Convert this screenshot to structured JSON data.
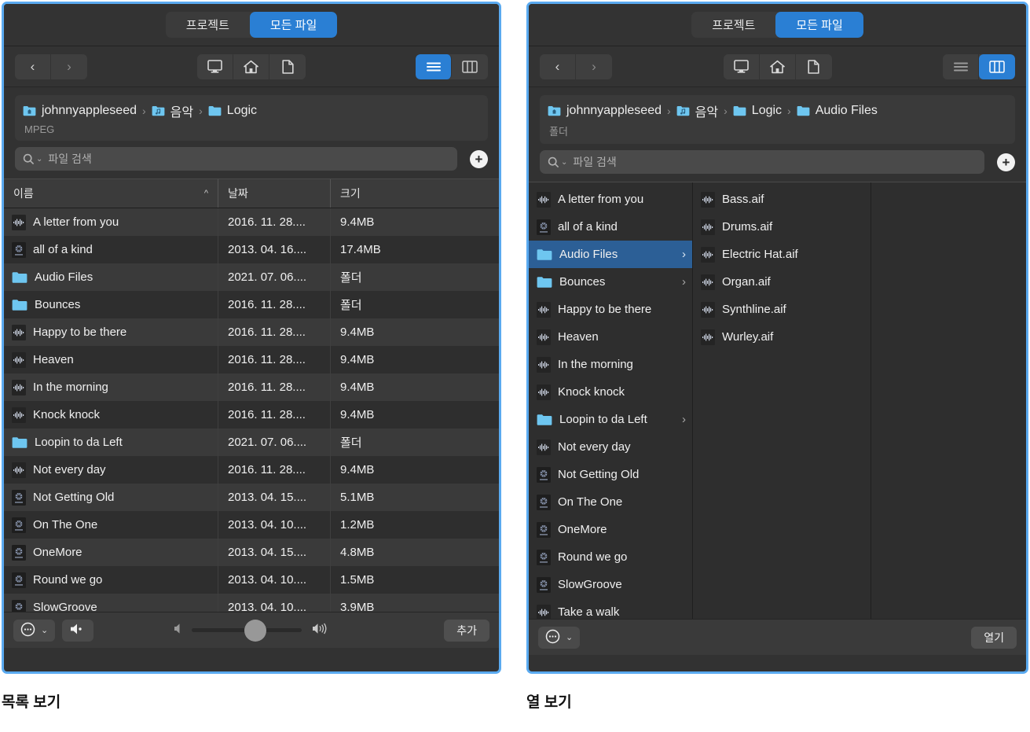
{
  "window_common": {
    "tabs": [
      {
        "label": "프로젝트",
        "active": false
      },
      {
        "label": "모든 파일",
        "active": true
      }
    ],
    "nav": {
      "back": "‹",
      "forward": "›"
    },
    "places": [
      {
        "name": "computer-icon"
      },
      {
        "name": "home-icon"
      },
      {
        "name": "document-icon"
      }
    ],
    "view_modes": [
      {
        "name": "list-view-icon"
      },
      {
        "name": "column-view-icon"
      }
    ],
    "search": {
      "placeholder": "파일 검색",
      "value": ""
    },
    "add_button": "+",
    "accent": "#2a7fd4",
    "folder_color": "#6ec6f0"
  },
  "list_panel": {
    "caption": "목록 보기",
    "view_selected": "list",
    "breadcrumb": [
      {
        "label": "johnnyappleseed",
        "icon": "home-folder-icon"
      },
      {
        "label": "음악",
        "icon": "music-folder-icon"
      },
      {
        "label": "Logic",
        "icon": "folder-icon"
      }
    ],
    "path_subtitle": "MPEG",
    "columns": [
      {
        "key": "name",
        "label": "이름",
        "sorted": true,
        "sort_arrow": "^"
      },
      {
        "key": "date",
        "label": "날짜"
      },
      {
        "key": "size",
        "label": "크기"
      }
    ],
    "rows": [
      {
        "icon": "waveform-icon",
        "name": "A letter from you",
        "date": "2016. 11. 28....",
        "size": "9.4MB"
      },
      {
        "icon": "project-icon",
        "name": "all of a kind",
        "date": "2013. 04. 16....",
        "size": "17.4MB"
      },
      {
        "icon": "folder-icon",
        "name": "Audio Files",
        "date": "2021. 07. 06....",
        "size": "폴더"
      },
      {
        "icon": "folder-icon",
        "name": "Bounces",
        "date": "2016. 11. 28....",
        "size": "폴더"
      },
      {
        "icon": "waveform-icon",
        "name": "Happy to be there",
        "date": "2016. 11. 28....",
        "size": "9.4MB"
      },
      {
        "icon": "waveform-icon",
        "name": "Heaven",
        "date": "2016. 11. 28....",
        "size": "9.4MB"
      },
      {
        "icon": "waveform-icon",
        "name": "In the morning",
        "date": "2016. 11. 28....",
        "size": "9.4MB"
      },
      {
        "icon": "waveform-icon",
        "name": "Knock knock",
        "date": "2016. 11. 28....",
        "size": "9.4MB"
      },
      {
        "icon": "folder-icon",
        "name": "Loopin to da Left",
        "date": "2021. 07. 06....",
        "size": "폴더"
      },
      {
        "icon": "waveform-icon",
        "name": "Not every day",
        "date": "2016. 11. 28....",
        "size": "9.4MB"
      },
      {
        "icon": "project-icon",
        "name": "Not Getting Old",
        "date": "2013. 04. 15....",
        "size": "5.1MB"
      },
      {
        "icon": "project-icon",
        "name": "On The One",
        "date": "2013. 04. 10....",
        "size": "1.2MB"
      },
      {
        "icon": "project-icon",
        "name": "OneMore",
        "date": "2013. 04. 15....",
        "size": "4.8MB"
      },
      {
        "icon": "project-icon",
        "name": "Round we go",
        "date": "2013. 04. 10....",
        "size": "1.5MB"
      },
      {
        "icon": "project-icon",
        "name": "SlowGroove",
        "date": "2013. 04. 10....",
        "size": "3.9MB"
      }
    ],
    "bottom": {
      "action_menu": "···",
      "action_menu_caret": "⌄",
      "speaker_button": "speaker-icon",
      "volume_low_icon": "volume-low-icon",
      "volume_high_icon": "volume-high-icon",
      "volume_percent": 58,
      "primary_button": "추가"
    }
  },
  "column_panel": {
    "caption": "열 보기",
    "view_selected": "column",
    "breadcrumb": [
      {
        "label": "johnnyappleseed",
        "icon": "home-folder-icon"
      },
      {
        "label": "음악",
        "icon": "music-folder-icon"
      },
      {
        "label": "Logic",
        "icon": "folder-icon"
      },
      {
        "label": "Audio Files",
        "icon": "folder-icon"
      }
    ],
    "path_subtitle": "폴더",
    "columns": [
      {
        "items": [
          {
            "icon": "waveform-icon",
            "label": "A letter from you",
            "chevron": false,
            "selected": false
          },
          {
            "icon": "project-icon",
            "label": "all of a kind",
            "chevron": false,
            "selected": false
          },
          {
            "icon": "folder-icon",
            "label": "Audio Files",
            "chevron": true,
            "selected": true
          },
          {
            "icon": "folder-icon",
            "label": "Bounces",
            "chevron": true,
            "selected": false
          },
          {
            "icon": "waveform-icon",
            "label": "Happy to be there",
            "chevron": false,
            "selected": false
          },
          {
            "icon": "waveform-icon",
            "label": "Heaven",
            "chevron": false,
            "selected": false
          },
          {
            "icon": "waveform-icon",
            "label": "In the morning",
            "chevron": false,
            "selected": false
          },
          {
            "icon": "waveform-icon",
            "label": "Knock knock",
            "chevron": false,
            "selected": false
          },
          {
            "icon": "folder-icon",
            "label": "Loopin to da Left",
            "chevron": true,
            "selected": false
          },
          {
            "icon": "waveform-icon",
            "label": "Not every day",
            "chevron": false,
            "selected": false
          },
          {
            "icon": "project-icon",
            "label": "Not Getting Old",
            "chevron": false,
            "selected": false
          },
          {
            "icon": "project-icon",
            "label": "On The One",
            "chevron": false,
            "selected": false
          },
          {
            "icon": "project-icon",
            "label": "OneMore",
            "chevron": false,
            "selected": false
          },
          {
            "icon": "project-icon",
            "label": "Round we go",
            "chevron": false,
            "selected": false
          },
          {
            "icon": "project-icon",
            "label": "SlowGroove",
            "chevron": false,
            "selected": false
          },
          {
            "icon": "waveform-icon",
            "label": "Take a walk",
            "chevron": false,
            "selected": false
          }
        ]
      },
      {
        "items": [
          {
            "icon": "waveform-icon",
            "label": "Bass.aif",
            "chevron": false,
            "selected": false
          },
          {
            "icon": "waveform-icon",
            "label": "Drums.aif",
            "chevron": false,
            "selected": false
          },
          {
            "icon": "waveform-icon",
            "label": "Electric Hat.aif",
            "chevron": false,
            "selected": false
          },
          {
            "icon": "waveform-icon",
            "label": "Organ.aif",
            "chevron": false,
            "selected": false
          },
          {
            "icon": "waveform-icon",
            "label": "Synthline.aif",
            "chevron": false,
            "selected": false
          },
          {
            "icon": "waveform-icon",
            "label": "Wurley.aif",
            "chevron": false,
            "selected": false
          }
        ]
      },
      {
        "items": []
      }
    ],
    "bottom": {
      "action_menu": "···",
      "action_menu_caret": "⌄",
      "primary_button": "열기"
    }
  }
}
